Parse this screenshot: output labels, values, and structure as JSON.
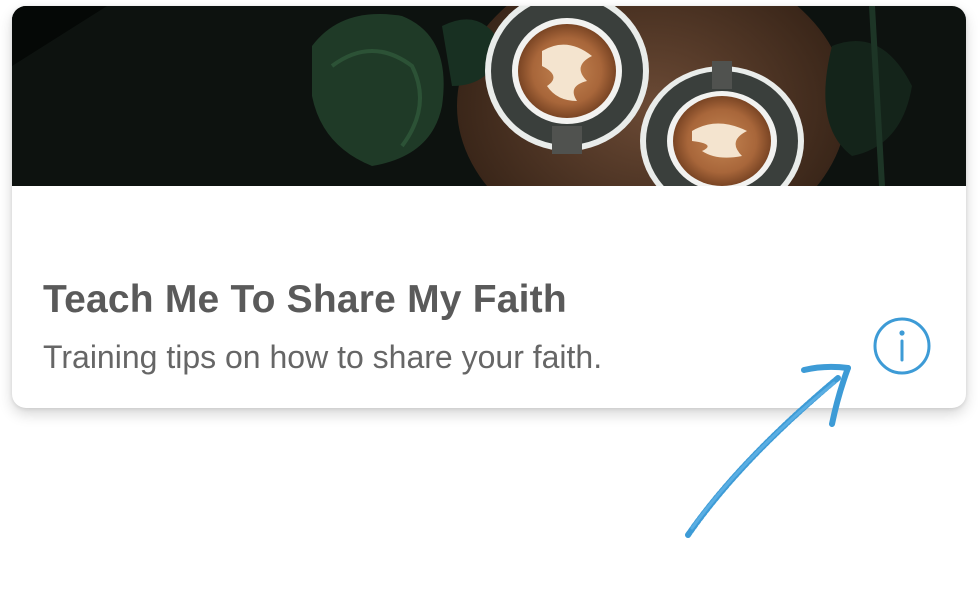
{
  "card": {
    "title": "Teach Me To Share My Faith",
    "subtitle": "Training tips on how to share your faith.",
    "image": "hero-image-coffee-cups-latte-art",
    "info_icon": "info-icon"
  },
  "annotation": {
    "arrow": "hand-drawn-arrow"
  },
  "colors": {
    "accent": "#3d9bd6",
    "title": "#5a5a5a",
    "subtitle": "#666666"
  }
}
